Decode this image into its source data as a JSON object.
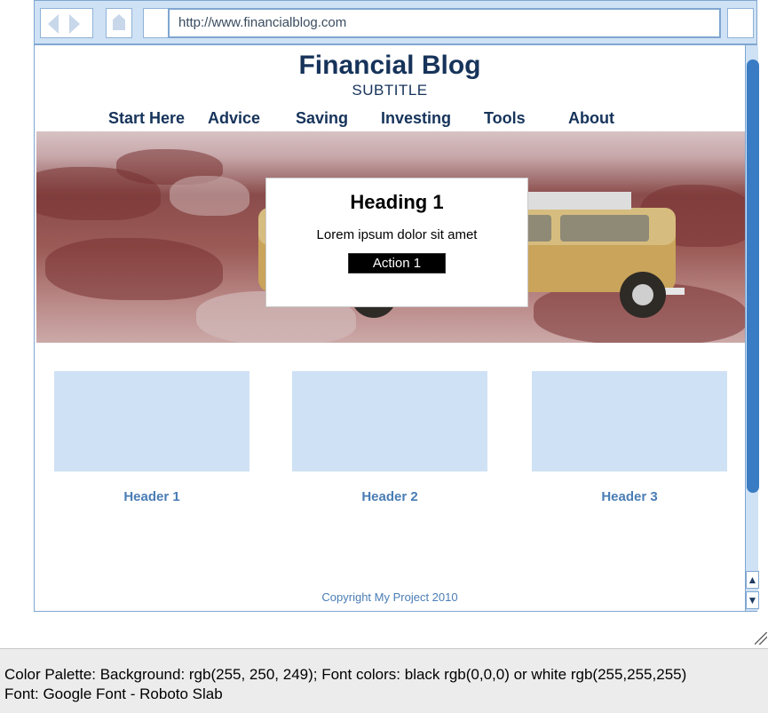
{
  "browser": {
    "url": "http://www.financialblog.com"
  },
  "site": {
    "title": "Financial Blog",
    "subtitle": "SUBTITLE",
    "nav": [
      "Start Here",
      "Advice",
      "Saving",
      "Investing",
      "Tools",
      "About"
    ]
  },
  "hero": {
    "heading": "Heading 1",
    "text": "Lorem ipsum dolor sit amet",
    "action_label": "Action 1"
  },
  "cards": [
    {
      "header": "Header 1"
    },
    {
      "header": "Header 2"
    },
    {
      "header": "Header 3"
    }
  ],
  "footer": {
    "copyright": "Copyright My Project 2010"
  },
  "scrollbar": {
    "up_glyph": "▲",
    "down_glyph": "▼"
  },
  "note": {
    "line1": "Color Palette: Background: rgb(255, 250, 249); Font colors: black rgb(0,0,0) or white rgb(255,255,255)",
    "line2": "Font: Google Font - Roboto Slab"
  },
  "colors": {
    "chrome": "#cfe1f4",
    "chrome_border": "#7fa6d1",
    "title": "#16335a",
    "link": "#4a7db5",
    "card_placeholder": "#cfe1f4",
    "scroll_thumb": "#3a7cc3"
  }
}
